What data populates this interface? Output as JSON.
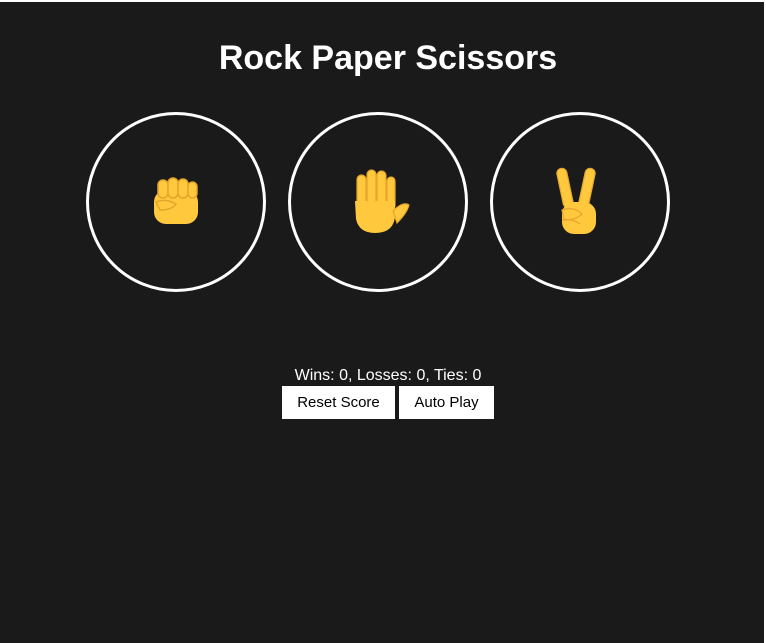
{
  "title": "Rock Paper Scissors",
  "moves": [
    {
      "name": "rock",
      "icon": "raised-fist-icon"
    },
    {
      "name": "paper",
      "icon": "raised-hand-icon"
    },
    {
      "name": "scissors",
      "icon": "victory-hand-icon"
    }
  ],
  "score": {
    "text": "Wins: 0, Losses: 0, Ties: 0",
    "wins": 0,
    "losses": 0,
    "ties": 0
  },
  "buttons": {
    "reset": "Reset Score",
    "auto_play": "Auto Play"
  },
  "colors": {
    "background": "#1a1a1a",
    "foreground": "#ffffff",
    "emoji_yellow": "#FFC83D"
  }
}
